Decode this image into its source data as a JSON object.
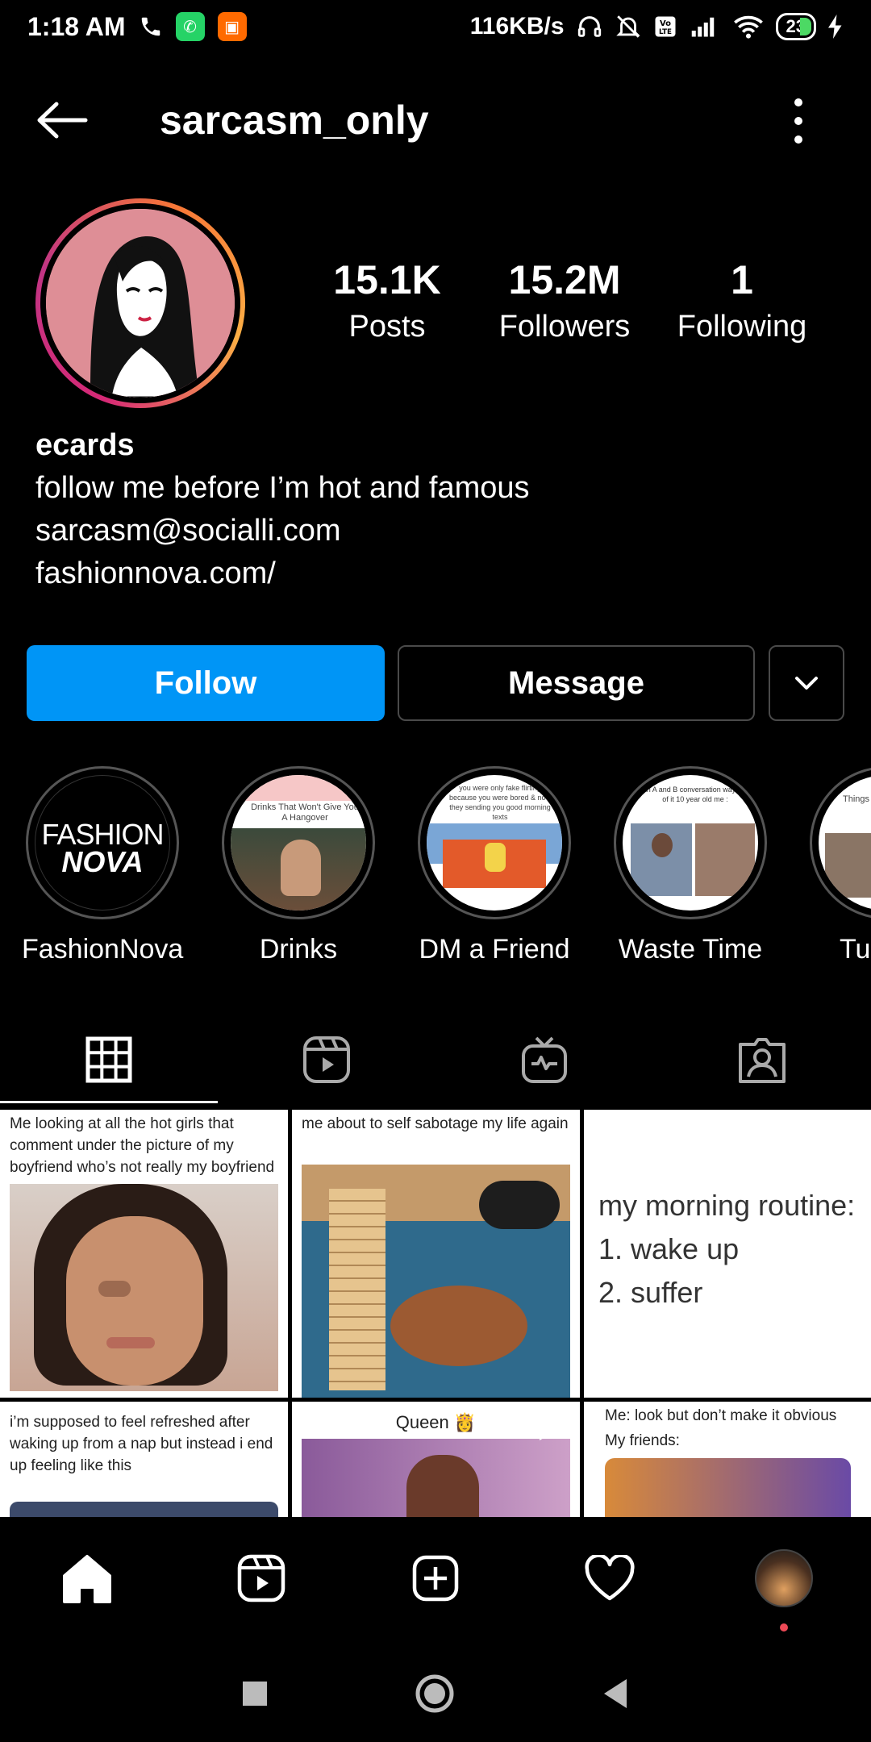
{
  "status_bar": {
    "time": "1:18 AM",
    "network_speed": "116KB/s",
    "battery": "23"
  },
  "header": {
    "username": "sarcasm_only"
  },
  "profile": {
    "stats": [
      {
        "value": "15.1K",
        "label": "Posts"
      },
      {
        "value": "15.2M",
        "label": "Followers"
      },
      {
        "value": "1",
        "label": "Following"
      }
    ],
    "bio": {
      "name": "ecards",
      "line1": "follow me before I’m hot and famous",
      "email": "sarcasm@socialli.com",
      "website": "fashionnova.com/"
    }
  },
  "actions": {
    "follow_label": "Follow",
    "message_label": "Message"
  },
  "highlights": [
    {
      "label": "FashionNova"
    },
    {
      "label": "Drinks"
    },
    {
      "label": "DM a Friend"
    },
    {
      "label": "Waste Time"
    },
    {
      "label": "Tu"
    }
  ],
  "highlight_art": {
    "fashionnova_top": "FASHION",
    "fashionnova_bottom": "NOVA",
    "drinks_text": "Drinks That Won't Give You A Hangover",
    "dm_text": "you were only fake flirting because you were bored & now they sending you good morning texts",
    "waste_text": "an A and B conversation way out of it 10 year old me :",
    "tu_text": "Things T"
  },
  "posts": [
    {
      "caption": "Me looking at all the hot girls that comment under the picture of my boyfriend who’s not really my boyfriend"
    },
    {
      "caption": "me about to self sabotage my life again"
    },
    {
      "caption": "my morning routine:",
      "line2": "1. wake up",
      "line3": "2. suffer"
    },
    {
      "caption": "i’m supposed to feel refreshed after waking up from a nap but instead i end up feeling like this"
    },
    {
      "caption": "Queen 👸"
    },
    {
      "caption": "Me: look but don’t make it obvious",
      "line2": "My friends:"
    }
  ],
  "colors": {
    "follow_blue": "#0095f6",
    "background": "#000000",
    "notification_dot": "#ed4956"
  }
}
